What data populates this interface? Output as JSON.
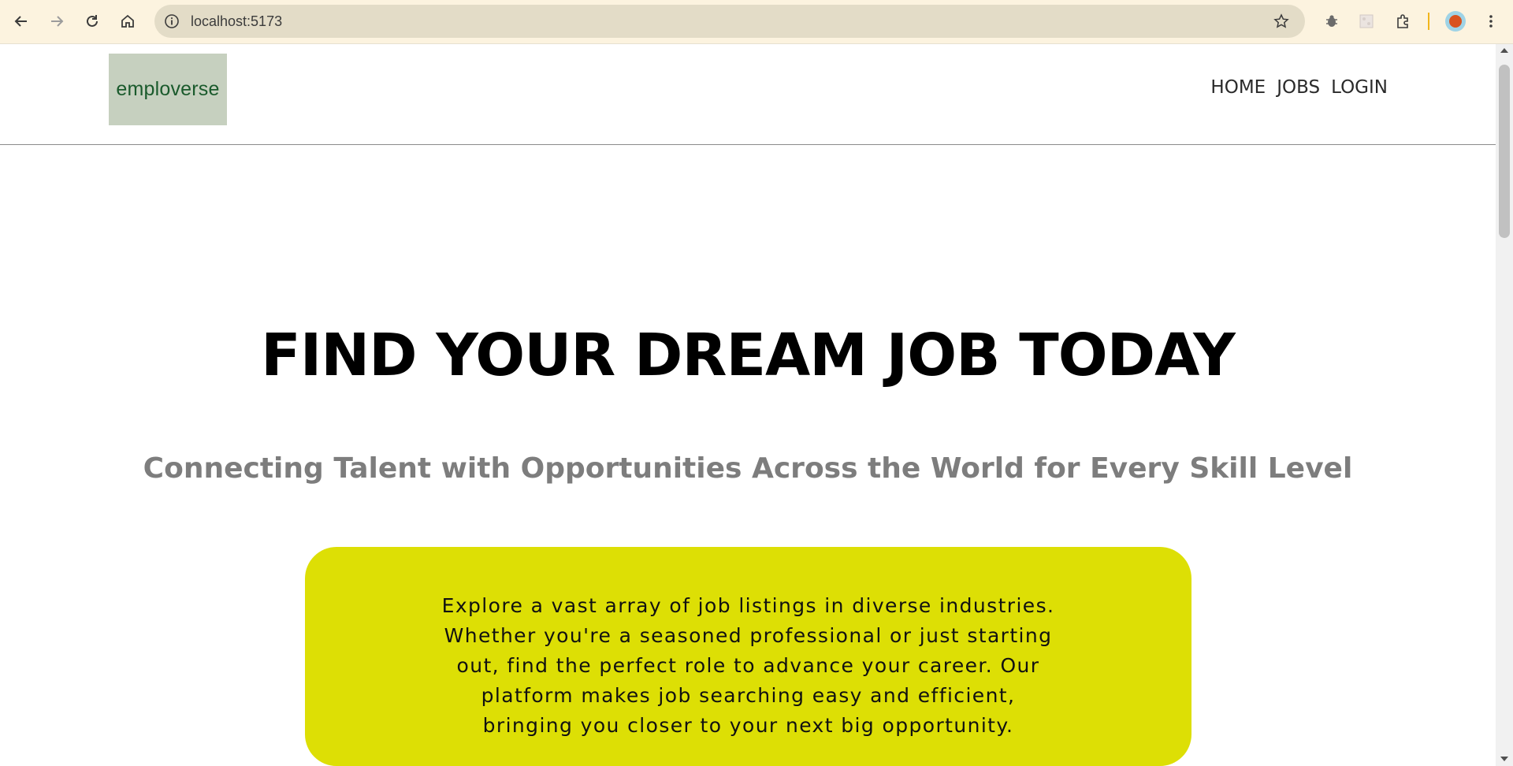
{
  "browser": {
    "url": "localhost:5173"
  },
  "site": {
    "logo_text": "emploverse",
    "nav": [
      {
        "label": "HOME"
      },
      {
        "label": "JOBS"
      },
      {
        "label": "LOGIN"
      }
    ]
  },
  "hero": {
    "title": "FIND YOUR DREAM JOB TODAY",
    "subtitle": "Connecting Talent with Opportunities Across the World for Every Skill Level",
    "description": "Explore a vast array of job listings in diverse industries. Whether you're a seasoned professional or just starting out, find the perfect role to advance your career. Our platform makes job searching easy and efficient, bringing you closer to your next big opportunity."
  },
  "colors": {
    "hero_box_bg": "#dddf05",
    "logo_bg": "#c6d0bf",
    "logo_text": "#1a5a2c",
    "subtitle": "#7d7d7d",
    "chrome_bg": "#fcf3df"
  }
}
